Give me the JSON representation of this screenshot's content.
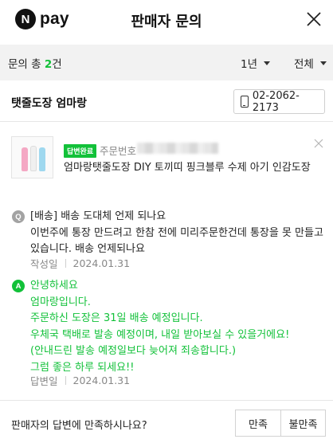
{
  "header": {
    "logo_badge": "N",
    "logo_text": "pay",
    "title": "판매자 문의",
    "close_icon": "close-icon"
  },
  "filter": {
    "count_label": "문의 총 ",
    "count_value": "2",
    "count_suffix": "건",
    "period": "1년",
    "status": "전체"
  },
  "seller": {
    "name": "탯줄도장 엄마랑",
    "phone": "02-2062-2173"
  },
  "product": {
    "badge": "답변완료",
    "order_label": "주문번호",
    "name": "엄마랑탯줄도장 DIY 토끼띠 핑크블루 수제 아기 인감도장"
  },
  "question": {
    "icon": "Q",
    "title": "[배송] 배송 도대체 언제 되나요",
    "body": "이번주에 통장 만드려고 한참 전에 미리주문한건데 통장을 못 만들고 있습니다. 배송 언제되나요",
    "date_label": "작성일",
    "date": "2024.01.31"
  },
  "answer": {
    "icon": "A",
    "lines": [
      "안녕하세요",
      "엄마랑입니다.",
      "주문하신 도장은 31일 배송 예정입니다.",
      "우체국 택배로 발송 예정이며, 내일 받아보실 수 있을거에요!",
      "(안내드린 발송 예정일보다 늦어져 죄송합니다.)",
      "그럼 좋은 하루 되세요!!"
    ],
    "date_label": "답변일",
    "date": "2024.01.31"
  },
  "footer": {
    "question": "판매자의 답변에 만족하시나요?",
    "yes_label": "만족",
    "no_label": "불만족"
  },
  "colors": {
    "accent_green": "#12c139",
    "filter_bg": "#f2f2f2",
    "question_icon": "#a3a3a3"
  }
}
